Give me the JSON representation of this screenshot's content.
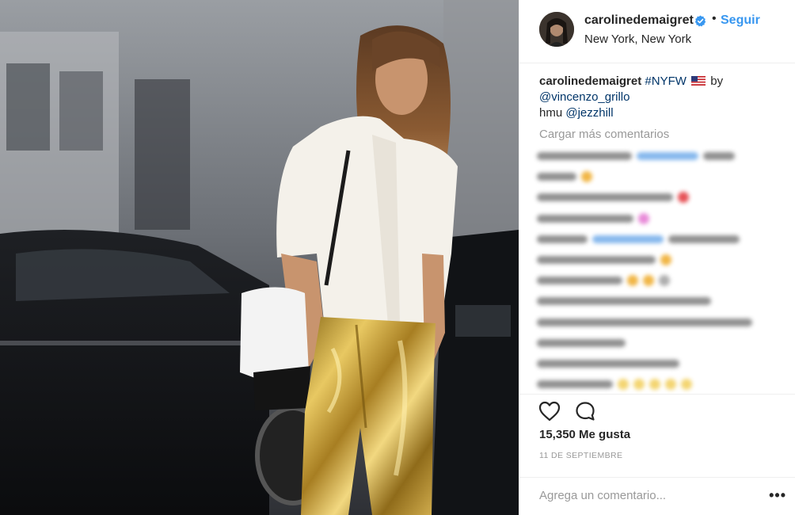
{
  "post": {
    "username": "carolinedemaigret",
    "verified": true,
    "separator": "•",
    "follow_label": "Seguir",
    "location": "New York, New York"
  },
  "caption": {
    "username": "carolinedemaigret",
    "hashtag": "#NYFW",
    "flag_icon": "us-flag-icon",
    "word_by": "by",
    "mention_1": "@vincenzo_grillo",
    "hmu": "hmu",
    "mention_2": "@jezzhill"
  },
  "comments": {
    "load_more_label": "Cargar más comentarios",
    "blurred": true
  },
  "actions": {
    "like_icon": "heart-outline-icon",
    "comment_icon": "comment-bubble-icon",
    "likes_text": "15,350 Me gusta",
    "date": "11 DE SEPTIEMBRE"
  },
  "comment_box": {
    "placeholder": "Agrega un comentario...",
    "more_label": "•••"
  },
  "colors": {
    "accent": "#3897f0",
    "text": "#262626",
    "muted": "#999999",
    "divider": "#efefef",
    "link": "#003569"
  }
}
